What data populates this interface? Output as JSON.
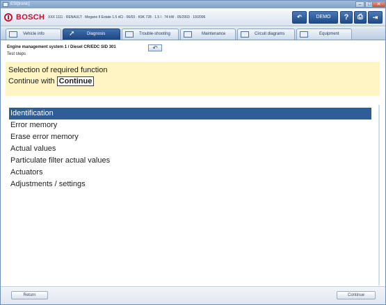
{
  "window": {
    "app_title": "ESI[tronic]",
    "min_glyph": "–",
    "max_glyph": "□",
    "close_glyph": "✕"
  },
  "header": {
    "vehicle_info": "XXX 1111 · RENAULT · Megane II Estate 1.5 dCi · 06/03 · K9K 728 · 1.5 l · 74 kW · 05/2003 · 10/2006",
    "buttons": {
      "back": "↶",
      "demo": "DEMO",
      "help": "?",
      "print": "⎙",
      "exit": "⇥"
    }
  },
  "tabs": [
    {
      "label": "Vehicle info",
      "active": false
    },
    {
      "label": "Diagnosis",
      "active": true
    },
    {
      "label": "Trouble-shooting",
      "active": false
    },
    {
      "label": "Maintenance",
      "active": false
    },
    {
      "label": "Circuit diagrams",
      "active": false
    },
    {
      "label": "Equipment",
      "active": false
    }
  ],
  "breadcrumb": {
    "system": "Engine management system 1 / Diesel CR/EDC SID 301",
    "step": "Test steps",
    "back_glyph": "↶"
  },
  "info_panel": {
    "line1": "Selection of required function",
    "continue_prefix": "Continue with",
    "continue_button": "Continue"
  },
  "function_list": {
    "selected_index": 0,
    "items": [
      "Identification",
      "Error memory",
      "Erase error memory",
      "Actual values",
      "Particulate filter actual values",
      "Actuators",
      "Adjustments / settings"
    ]
  },
  "footer": {
    "left_button": "Return",
    "right_button": "Continue"
  },
  "colors": {
    "bosch_red": "#c8102e",
    "selection_blue": "#2e5d98",
    "info_yellow": "#fff4c3",
    "header_blue": "#1f4a86"
  },
  "icons": {
    "vehicle_info": "document-icon",
    "diagnosis": "probe-icon",
    "trouble_shooting": "car-icon",
    "maintenance": "wrench-icon",
    "circuit_diagrams": "circuit-icon",
    "equipment": "book-icon"
  }
}
